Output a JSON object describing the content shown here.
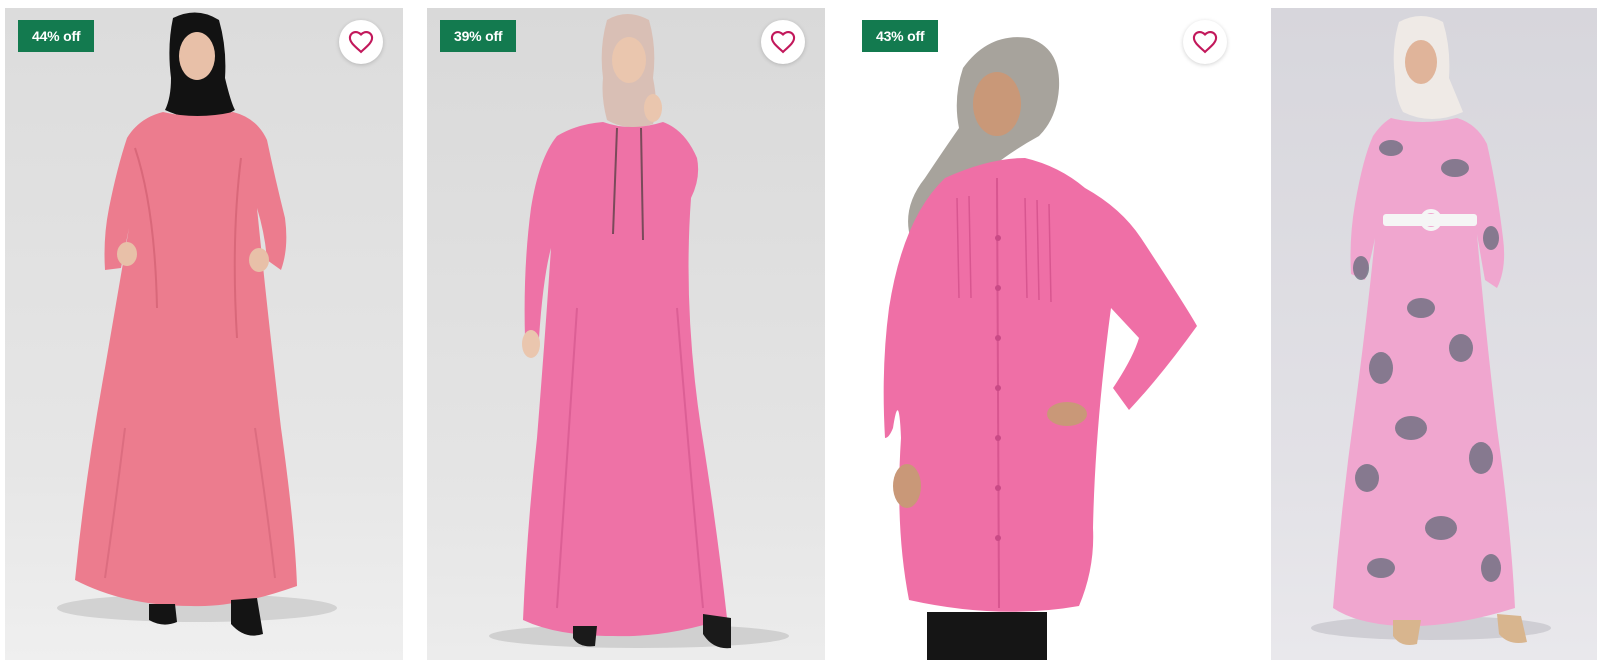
{
  "colors": {
    "badge_bg": "#137a4f",
    "badge_text": "#ffffff",
    "heart_stroke": "#c2185b",
    "dress_pink_1": "#ec7c8e",
    "dress_pink_2": "#ee72a6",
    "shirt_pink": "#ef6fa6",
    "floral_pink": "#f0a6cf"
  },
  "products": [
    {
      "discount_label": "44% off",
      "wishlist_icon": "heart-outline-icon",
      "image": "woman-black-hijab-coral-pink-abaya"
    },
    {
      "discount_label": "39% off",
      "wishlist_icon": "heart-outline-icon",
      "image": "woman-beige-hijab-pink-hooded-abaya"
    },
    {
      "discount_label": "43% off",
      "wishlist_icon": "heart-outline-icon",
      "image": "woman-grey-headscarf-pink-pintuck-tunic"
    },
    {
      "discount_label": "",
      "wishlist_icon": "",
      "image": "woman-white-hijab-pink-floral-maxi-dress"
    }
  ]
}
